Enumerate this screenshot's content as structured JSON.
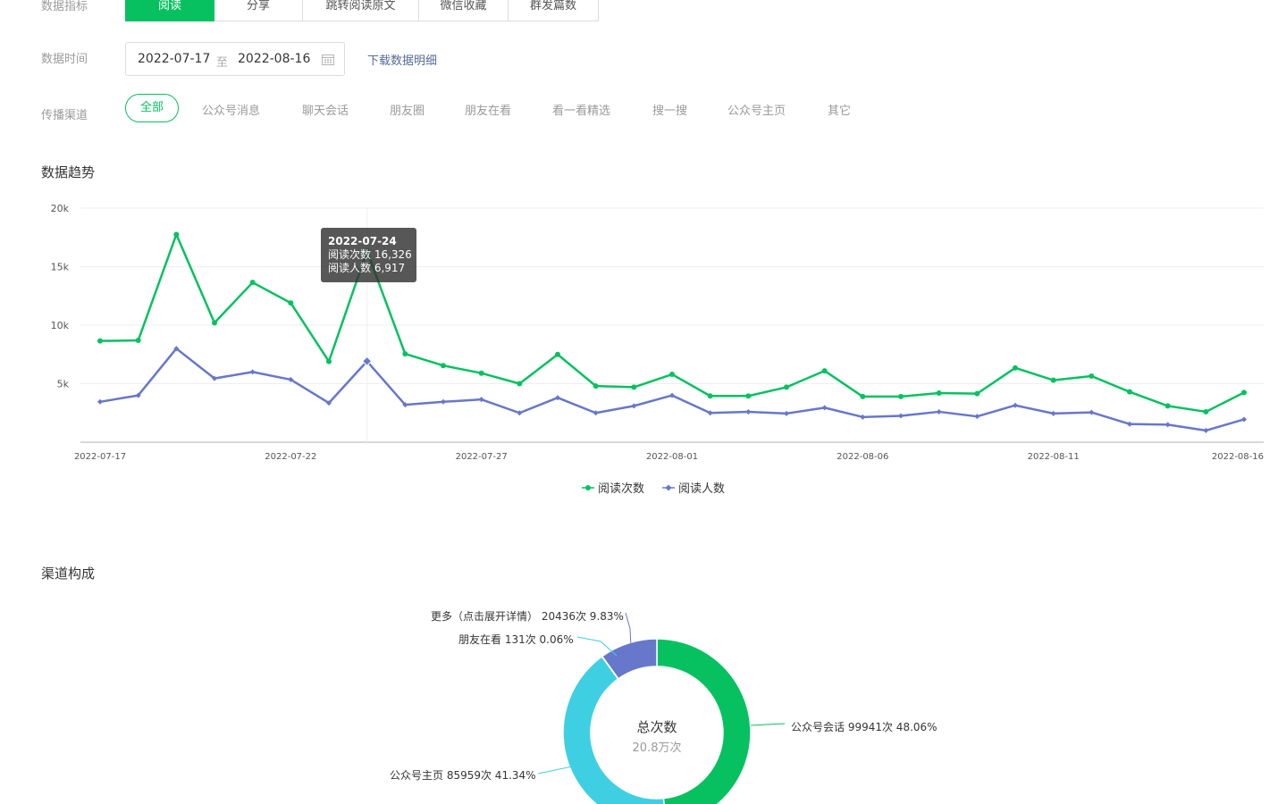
{
  "filters": {
    "metric_label": "数据指标",
    "metric_tabs": [
      {
        "label": "阅读",
        "active": true
      },
      {
        "label": "分享",
        "active": false
      },
      {
        "label": "跳转阅读原文",
        "active": false
      },
      {
        "label": "微信收藏",
        "active": false
      },
      {
        "label": "群发篇数",
        "active": false
      }
    ],
    "time_label": "数据时间",
    "date_start": "2022-07-17",
    "date_sep": "至",
    "date_end": "2022-08-16",
    "download_label": "下载数据明细",
    "channel_label": "传播渠道",
    "channels": [
      {
        "label": "全部",
        "active": true
      },
      {
        "label": "公众号消息",
        "active": false
      },
      {
        "label": "聊天会话",
        "active": false
      },
      {
        "label": "朋友圈",
        "active": false
      },
      {
        "label": "朋友在看",
        "active": false
      },
      {
        "label": "看一看精选",
        "active": false
      },
      {
        "label": "搜一搜",
        "active": false
      },
      {
        "label": "公众号主页",
        "active": false
      },
      {
        "label": "其它",
        "active": false
      }
    ]
  },
  "trend": {
    "section_title": "数据趋势",
    "tooltip": {
      "date": "2022-07-24",
      "line1": "阅读次数 16,326",
      "line2": "阅读人数 6,917"
    }
  },
  "chart_data": [
    {
      "type": "line",
      "x": [
        "2022-07-17",
        "2022-07-18",
        "2022-07-19",
        "2022-07-20",
        "2022-07-21",
        "2022-07-22",
        "2022-07-23",
        "2022-07-24",
        "2022-07-25",
        "2022-07-26",
        "2022-07-27",
        "2022-07-28",
        "2022-07-29",
        "2022-07-30",
        "2022-07-31",
        "2022-08-01",
        "2022-08-02",
        "2022-08-03",
        "2022-08-04",
        "2022-08-05",
        "2022-08-06",
        "2022-08-07",
        "2022-08-08",
        "2022-08-09",
        "2022-08-10",
        "2022-08-11",
        "2022-08-12",
        "2022-08-13",
        "2022-08-14",
        "2022-08-15",
        "2022-08-16"
      ],
      "x_tick_labels": [
        "2022-07-17",
        "2022-07-22",
        "2022-07-27",
        "2022-08-01",
        "2022-08-06",
        "2022-08-11",
        "2022-08-16"
      ],
      "y_tick_labels": [
        "5k",
        "10k",
        "15k",
        "20k"
      ],
      "ylim": [
        0,
        20000
      ],
      "grid": true,
      "legend": "bottom-center",
      "series": [
        {
          "name": "阅读次数",
          "color": "#07c160",
          "values": [
            8650,
            8700,
            17750,
            10200,
            13650,
            11900,
            6900,
            16326,
            7550,
            6550,
            5900,
            5000,
            7500,
            4800,
            4700,
            5800,
            3950,
            3950,
            4700,
            6100,
            3900,
            3900,
            4200,
            4150,
            6350,
            5300,
            5650,
            4300,
            3100,
            2600,
            4250
          ]
        },
        {
          "name": "阅读人数",
          "color": "#6777cb",
          "values": [
            3450,
            4000,
            8000,
            5450,
            6000,
            5350,
            3350,
            6917,
            3200,
            3450,
            3650,
            2500,
            3800,
            2500,
            3100,
            4000,
            2500,
            2600,
            2450,
            2950,
            2150,
            2250,
            2600,
            2200,
            3150,
            2450,
            2550,
            1550,
            1500,
            1000,
            1950
          ]
        }
      ]
    },
    {
      "type": "pie",
      "title": "总次数",
      "center_value": "20.8万次",
      "slices": [
        {
          "label": "公众号会话",
          "value": 99941,
          "pct": "48.06%",
          "text": "公众号会话 99941次 48.06%",
          "color": "#07c160"
        },
        {
          "label": "公众号主页",
          "value": 85959,
          "pct": "41.34%",
          "text": "公众号主页 85959次 41.34%",
          "color": "#3fcfe2"
        },
        {
          "label": "朋友在看",
          "value": 131,
          "pct": "0.06%",
          "text": "朋友在看 131次 0.06%",
          "color": "#a0d8b0"
        },
        {
          "label": "更多（点击展开详情）",
          "value": 20436,
          "pct": "9.83%",
          "text": "更多（点击展开详情） 20436次 9.83%",
          "color": "#6677cc"
        }
      ]
    }
  ],
  "composition": {
    "section_title": "渠道构成"
  }
}
